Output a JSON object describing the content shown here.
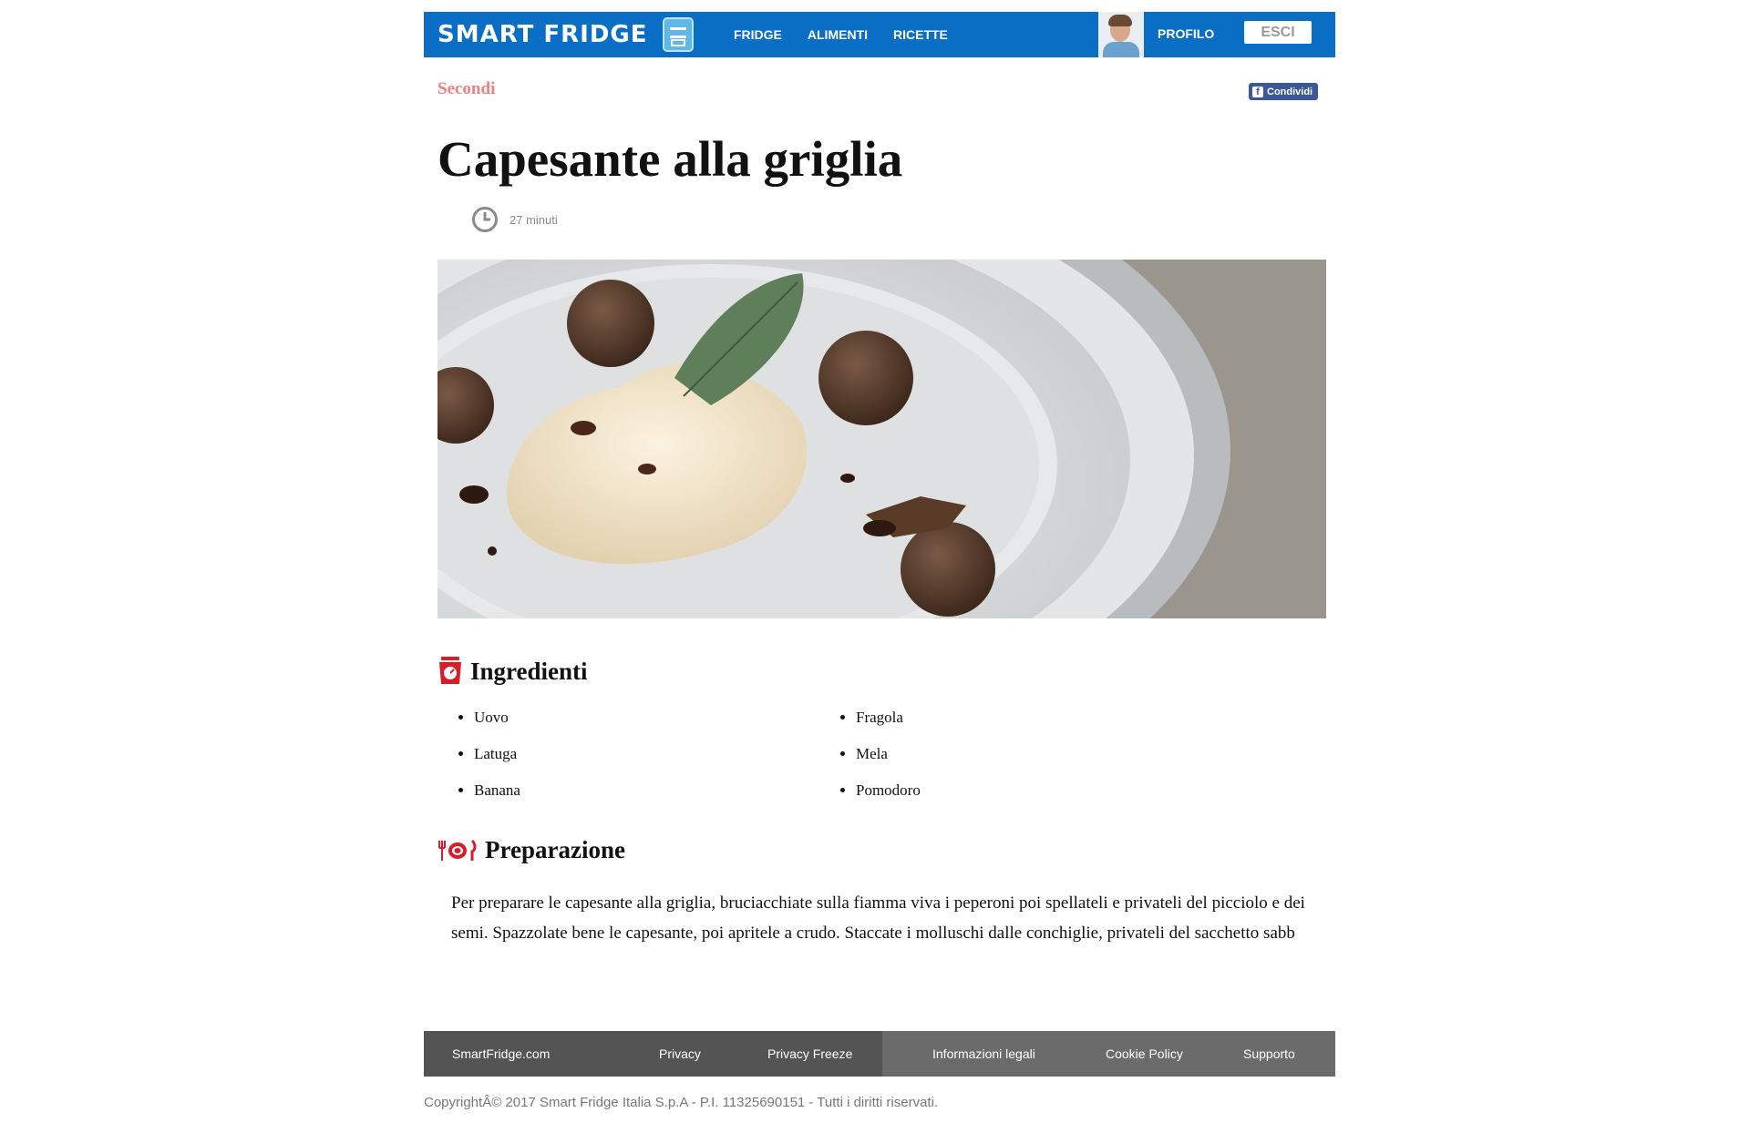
{
  "header": {
    "logo_text": "SMART FRIDGE",
    "logo_icon": "fridge-icon",
    "nav": [
      "FRIDGE",
      "ALIMENTI",
      "RICETTE"
    ],
    "profile_label": "PROFILO",
    "logout_label": "ESCI",
    "brand_color": "#0a6fc4"
  },
  "recipe": {
    "category": "Secondi",
    "share_label": "Condividi",
    "title": "Capesante alla griglia",
    "time": "27 minuti",
    "ingredients_heading": "Ingredienti",
    "ingredients_col1": [
      "Uovo",
      "Latuga",
      "Banana"
    ],
    "ingredients_col2": [
      "Fragola",
      "Mela",
      "Pomodoro"
    ],
    "preparation_heading": "Preparazione",
    "preparation_text": "Per preparare le capesante alla griglia, bruciacchiate sulla fiamma viva i peperoni poi spellateli e privateli del picciolo e dei semi. Spazzolate bene le capesante, poi apritele a crudo. Staccate i molluschi dalle conchiglie, privateli del sacchetto sabb"
  },
  "footer": {
    "links": [
      "SmartFridge.com",
      "Privacy",
      "Privacy Freeze",
      "Informazioni legali",
      "Cookie Policy",
      "Supporto"
    ],
    "copyright": "CopyrightÂ© 2017 Smart Fridge Italia S.p.A - P.I. 11325690151 - Tutti i diritti riservati."
  },
  "colors": {
    "category": "#f07f7f",
    "accent_icon": "#d91c2c",
    "footer_dark": "#545454",
    "footer_light": "#6b6b6b"
  }
}
